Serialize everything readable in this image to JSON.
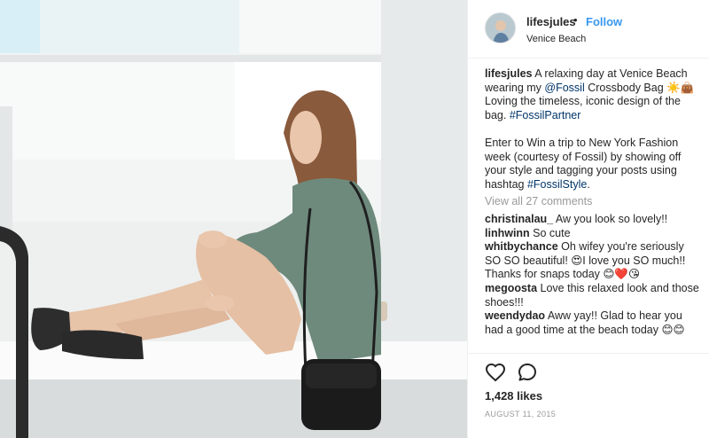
{
  "post": {
    "username": "lifesjules",
    "separator": "•",
    "follow_label": "Follow",
    "location": "Venice Beach",
    "caption": {
      "username": "lifesjules",
      "text_1": " A relaxing day at Venice Beach wearing my ",
      "mention": "@Fossil",
      "text_2": " Crossbody Bag ☀️👜 Loving the timeless, iconic design of the bag. ",
      "hashtag_1": "#FossilPartner",
      "text_3": "Enter to Win a trip to New York Fashion week (courtesy of Fossil) by showing off your style and tagging your posts using hashtag ",
      "hashtag_2": "#FossilStyle",
      "text_4": "."
    },
    "view_all_comments": "View all 27 comments",
    "comments": [
      {
        "user": "christinalau_",
        "text": "Aw you look so lovely!!"
      },
      {
        "user": "linhwinn",
        "text": "So cute"
      },
      {
        "user": "whitbychance",
        "text": "Oh wifey you're seriously SO SO beautiful! 😍I love you SO much!! Thanks for snaps today 😊❤️😘"
      },
      {
        "user": "megoosta",
        "text": "Love this relaxed look and those shoes!!!"
      },
      {
        "user": "weendydao",
        "text": "Aww yay!! Glad to hear you had a good time at the beach today 😊😊"
      }
    ],
    "likes": "1,428 likes",
    "date": "AUGUST 11, 2015"
  },
  "icons": {
    "heart": "heart-icon",
    "comment": "comment-bubble-icon"
  },
  "colors": {
    "link": "#003569",
    "follow": "#3897f0",
    "muted": "#999999",
    "text": "#262626"
  }
}
